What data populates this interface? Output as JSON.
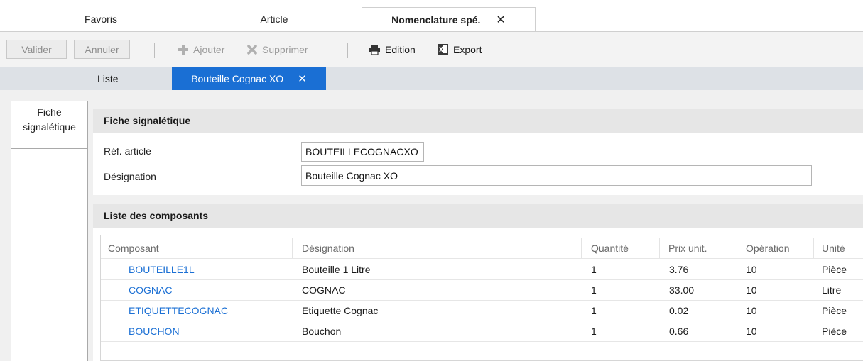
{
  "top_tabs": [
    {
      "label": "Favoris"
    },
    {
      "label": "Article"
    },
    {
      "label": "Nomenclature spé.",
      "close": "✕"
    }
  ],
  "toolbar": {
    "validate_label": "Valider",
    "cancel_label": "Annuler",
    "add_label": "Ajouter",
    "delete_label": "Supprimer",
    "edition_label": "Edition",
    "export_label": "Export"
  },
  "inner_tabs": [
    {
      "label": "Liste"
    },
    {
      "label": "Bouteille Cognac XO",
      "close": "✕"
    }
  ],
  "side_tab": {
    "line1": "Fiche",
    "line2": "signalétique"
  },
  "fiche": {
    "title": "Fiche signalétique",
    "ref_label": "Réf. article",
    "ref_value": "BOUTEILLECOGNACXO",
    "des_label": "Désignation",
    "des_value": "Bouteille Cognac XO"
  },
  "components": {
    "title": "Liste des composants",
    "columns": [
      "Composant",
      "Désignation",
      "Quantité",
      "Prix unit.",
      "Opération",
      "Unité"
    ],
    "rows": [
      [
        "BOUTEILLE1L",
        "Bouteille 1 Litre",
        "1",
        "3.76",
        "10",
        "Pièce"
      ],
      [
        "COGNAC",
        "COGNAC",
        "1",
        "33.00",
        "10",
        "Litre"
      ],
      [
        "ETIQUETTECOGNAC",
        "Etiquette Cognac",
        "1",
        "0.02",
        "10",
        "Pièce"
      ],
      [
        "BOUCHON",
        "Bouchon",
        "1",
        "0.66",
        "10",
        "Pièce"
      ]
    ]
  },
  "colors": {
    "accent": "#1a6fd4",
    "link": "#1a6fd4"
  }
}
